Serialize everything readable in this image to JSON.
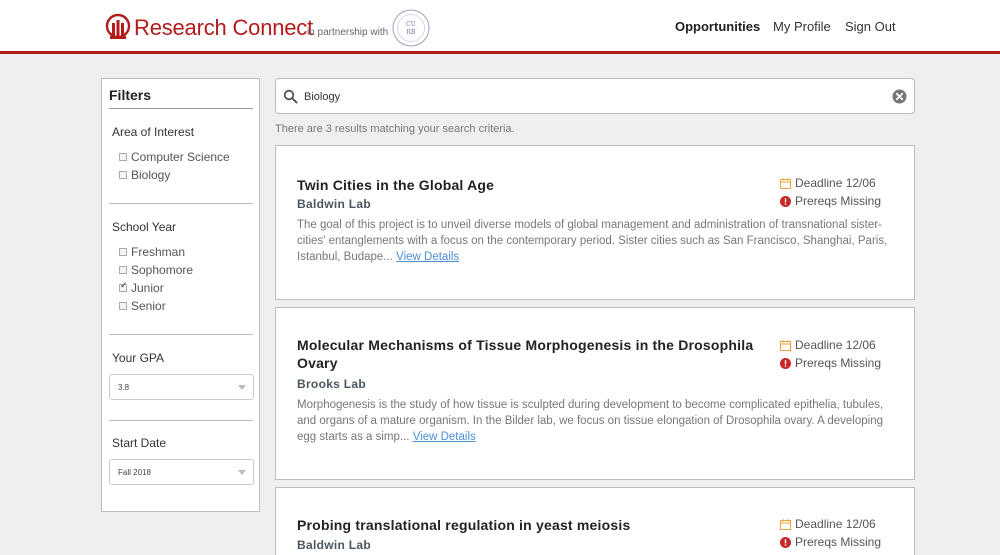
{
  "header": {
    "brand": "Research Connect",
    "partner_text": "in partnership with",
    "seal_text": "CU RB",
    "nav": [
      "Opportunities",
      "My Profile",
      "Sign Out"
    ],
    "active_nav": "Opportunities",
    "accent_color": "#b31b1b"
  },
  "filters": {
    "title": "Filters",
    "area_of_interest": {
      "heading": "Area of Interest",
      "options": [
        {
          "label": "Computer Science",
          "checked": false
        },
        {
          "label": "Biology",
          "checked": false
        }
      ]
    },
    "school_year": {
      "heading": "School Year",
      "options": [
        {
          "label": "Freshman",
          "checked": false
        },
        {
          "label": "Sophomore",
          "checked": false
        },
        {
          "label": "Junior",
          "checked": true
        },
        {
          "label": "Senior",
          "checked": false
        }
      ]
    },
    "gpa": {
      "heading": "Your GPA",
      "value": "3.8"
    },
    "start_date": {
      "heading": "Start Date",
      "value": "Fall 2018"
    }
  },
  "search": {
    "value": "Biology",
    "result_text": "There are 3 results matching your search criteria."
  },
  "results": [
    {
      "title": "Twin Cities in the Global Age",
      "lab": "Baldwin Lab",
      "deadline": "Deadline 12/06",
      "prereqs": "Prereqs Missing",
      "desc": "The goal of this project is to unveil diverse models of global management and administration of transnational sister-cities' entanglements with a focus on the contemporary period. Sister cities such as San Francisco, Shanghai, Paris, Istanbul, Budape... ",
      "link": "View Details"
    },
    {
      "title": "Molecular Mechanisms of Tissue Morphogenesis in the Drosophila Ovary",
      "lab": "Brooks Lab",
      "deadline": "Deadline 12/06",
      "prereqs": "Prereqs Missing",
      "desc": "Morphogenesis is the study of how tissue is sculpted during development to become complicated epithelia, tubules, and organs of a mature organism. In the Bilder lab, we focus on tissue elongation of Drosophila ovary. A developing egg starts as a simp... ",
      "link": "View Details"
    },
    {
      "title": "Probing translational regulation in yeast meiosis",
      "lab": "Baldwin Lab",
      "deadline": "Deadline 12/06",
      "prereqs": "Prereqs Missing"
    }
  ]
}
